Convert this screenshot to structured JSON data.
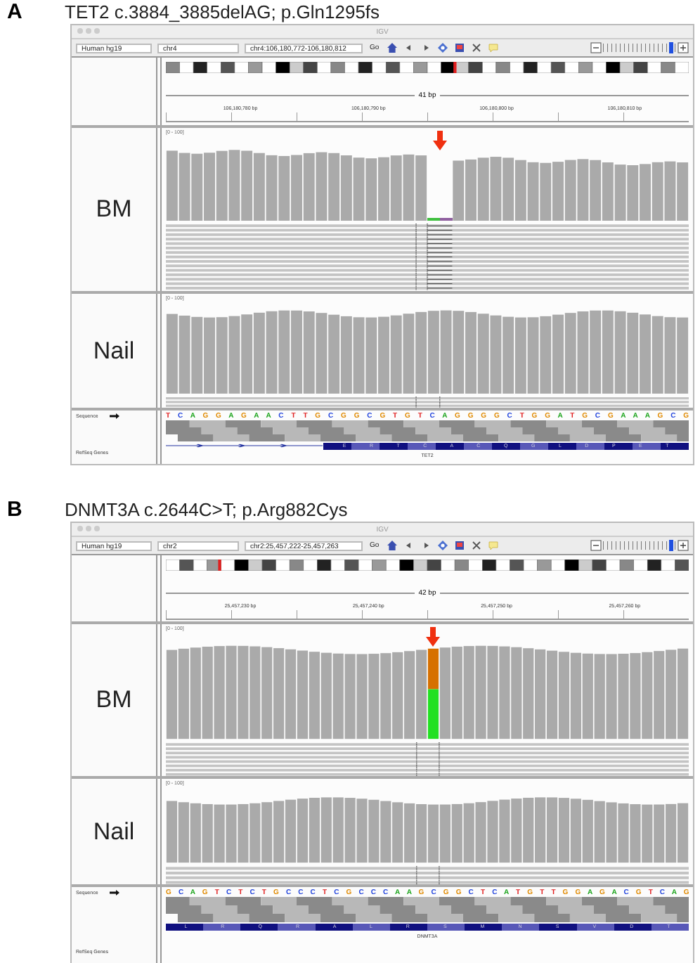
{
  "panels": [
    {
      "label": "A",
      "title": "TET2 c.3884_3885delAG; p.Gln1295fs",
      "window": {
        "title": "IGV"
      },
      "toolbar": {
        "genome": "Human hg19",
        "chromosome": "chr4",
        "locus": "chr4:106,180,772-106,180,812",
        "go": "Go",
        "zoom": {
          "level": 0.93
        }
      },
      "ruler": {
        "span": "41 bp",
        "ticks": [
          "106,180,780 bp",
          "106,180,790 bp",
          "106,180,800 bp",
          "106,180,810 bp"
        ]
      },
      "tracks": [
        {
          "name": "BM",
          "range": "[0 - 100]",
          "mutation": {
            "kind": "deletion"
          }
        },
        {
          "name": "Nail",
          "range": "[0 - 100]"
        }
      ],
      "sequence": {
        "label": "Sequence",
        "bases": "T C A G G A G A A C T T G C G G C G T G T C A G G G G C T G G A T G C G A A A G C G"
      },
      "genes": {
        "label": "RefSeq Genes",
        "intron_left": true,
        "amino_acids": "E R T C A C Q G L D P E T",
        "gene": "TET2"
      }
    },
    {
      "label": "B",
      "title": "DNMT3A c.2644C>T; p.Arg882Cys",
      "window": {
        "title": "IGV"
      },
      "toolbar": {
        "genome": "Human hg19",
        "chromosome": "chr2",
        "locus": "chr2:25,457,222-25,457,263",
        "go": "Go",
        "zoom": {
          "level": 0.93
        }
      },
      "ruler": {
        "span": "42 bp",
        "ticks": [
          "25,457,230 bp",
          "25,457,240 bp",
          "25,457,250 bp",
          "25,457,260 bp"
        ]
      },
      "tracks": [
        {
          "name": "BM",
          "range": "[0 - 100]",
          "mutation": {
            "kind": "snv"
          }
        },
        {
          "name": "Nail",
          "range": "[0 - 100]"
        }
      ],
      "sequence": {
        "label": "Sequence",
        "bases": "G C A G T C T C T G C C C T C G C C C A A G C G G C T C A T G T T G G A G A C G T C A G"
      },
      "genes": {
        "label": "RefSeq Genes",
        "intron_left": false,
        "amino_acids": "L R Q R A L R S M N S V D T",
        "gene": "DNMT3A"
      }
    }
  ]
}
